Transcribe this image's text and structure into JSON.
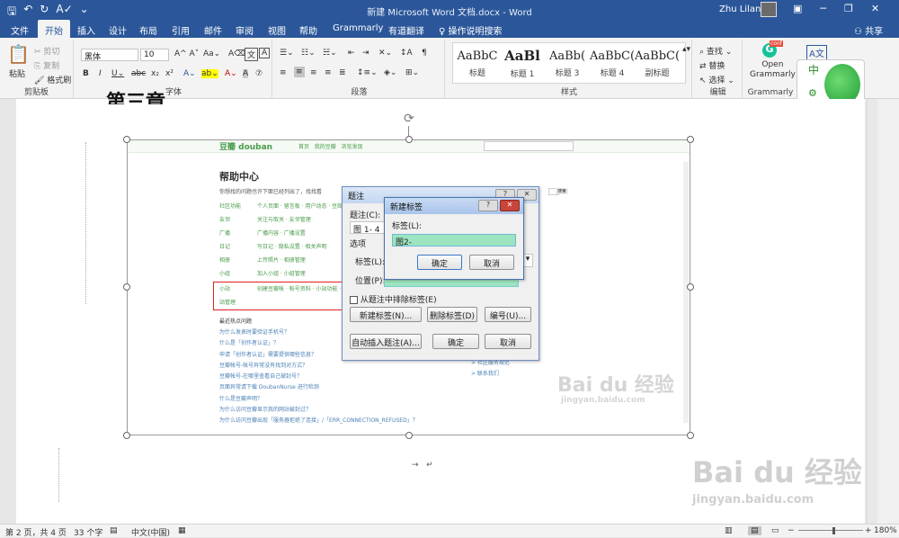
{
  "titlebar": {
    "title": "新建 Microsoft Word 文档.docx  -  Word",
    "user": "Zhu Lilan"
  },
  "tabs": [
    "文件",
    "开始",
    "插入",
    "设计",
    "布局",
    "引用",
    "邮件",
    "审阅",
    "视图",
    "帮助",
    "Grammarly",
    "有道翻译"
  ],
  "search_label": "操作说明搜索",
  "share_label": "共享",
  "ribbon": {
    "clipboard": {
      "paste": "粘贴",
      "cut": "剪切",
      "copy": "复制",
      "format_painter": "格式刷",
      "label": "剪贴板"
    },
    "font": {
      "name": "黑体",
      "size": "10",
      "label": "字体"
    },
    "paragraph": {
      "label": "段落"
    },
    "styles": {
      "label": "样式",
      "items": [
        {
          "preview": "AaBbC",
          "name": "标题"
        },
        {
          "preview": "AaBl",
          "name": "标题 1"
        },
        {
          "preview": "AaBb(",
          "name": "标题 3"
        },
        {
          "preview": "AaBbC(",
          "name": "标题 4"
        },
        {
          "preview": "AaBbC(",
          "name": "副标题"
        }
      ]
    },
    "editing": {
      "find": "查找",
      "replace": "替换",
      "select": "选择",
      "label": "编辑"
    },
    "grammarly": {
      "open": "Open\nGrammarly",
      "label": "Grammarly",
      "badge": "conf"
    }
  },
  "doc": {
    "heading_partial": "第三章",
    "screenshot": {
      "help_title": "帮助中心",
      "help_sub": "你想找的问题也许下面已经列出了，找找看",
      "rows": [
        {
          "k": "社区功能",
          "v": "个人页面 · 留言板 · 用户动态 · 豆邮"
        },
        {
          "k": "友邻",
          "v": "关注与取关 · 友邻管理"
        },
        {
          "k": "广播",
          "v": "广播内容 · 广播设置"
        },
        {
          "k": "日记",
          "v": "写日记 · 隐私设置 · 相关声明"
        },
        {
          "k": "相册",
          "v": "上传照片 · 相册管理"
        },
        {
          "k": "小组",
          "v": "加入小组 · 小组管理"
        },
        {
          "k": "小站",
          "v": "创建豆瓣帐 · 帐号资料 · 小站功能 · 小站管理"
        }
      ],
      "faq_title": "最近热点问题",
      "faq": [
        "为什么发表时要验证手机号？",
        "什么是「创作者认证」？",
        "申请「创作者认证」需要提供哪些信息？",
        "豆瓣帐号-帐号异常没有找到对方式？",
        "豆瓣帐号-在哪里查看自己被封号？",
        "页面异常请下载 DoubanNurse 进行检测",
        "什么是豆瓣声明？",
        "为什么访问豆瓣显示我的网站被封过？",
        "为什么访问豆瓣出现「服务器拒绝了连接」/「ERR_CONNECTION_REFUSED」？"
      ],
      "links": [
        "> 社区服务规范",
        "> 联系我们"
      ]
    }
  },
  "caption_dialog": {
    "title": "题注",
    "caption_label": "题注(C):",
    "caption_value": "图 1- 4",
    "options_label": "选项",
    "label_label": "标签(L):",
    "position_label": "位置(P):",
    "exclude_label": "从题注中排除标签(E)",
    "new_label_btn": "新建标签(N)...",
    "delete_label_btn": "删除标签(D)",
    "numbering_btn": "编号(U)...",
    "autocaption_btn": "自动插入题注(A)...",
    "ok": "确定",
    "cancel": "取消"
  },
  "new_label_dialog": {
    "title": "新建标签",
    "label_label": "标签(L):",
    "label_value": "图2-",
    "ok": "确定",
    "cancel": "取消"
  },
  "statusbar": {
    "page": "第 2 页，共 4 页",
    "words": "33 个字",
    "lang": "中文(中国)",
    "zoom": "180%"
  },
  "watermark": {
    "brand": "Bai du 经验",
    "url": "jingyan.baidu.com"
  }
}
